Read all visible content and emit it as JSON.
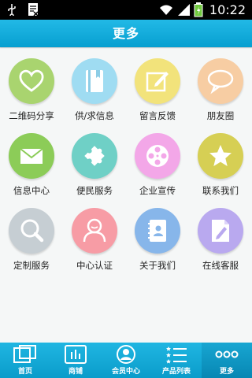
{
  "status": {
    "time": "10:22"
  },
  "header": {
    "title": "更多"
  },
  "grid": [
    {
      "label": "二维码分享",
      "icon": "heart-icon",
      "color": "#a9d46f"
    },
    {
      "label": "供/求信息",
      "icon": "book-icon",
      "color": "#9fdcf2"
    },
    {
      "label": "留言反馈",
      "icon": "edit-note-icon",
      "color": "#f2e37b"
    },
    {
      "label": "朋友圈",
      "icon": "speech-bubble-icon",
      "color": "#f7cda3"
    },
    {
      "label": "信息中心",
      "icon": "mail-icon",
      "color": "#8ccc58"
    },
    {
      "label": "便民服务",
      "icon": "puzzle-icon",
      "color": "#6fd0c6"
    },
    {
      "label": "企业宣传",
      "icon": "film-reel-icon",
      "color": "#f3a7e8"
    },
    {
      "label": "联系我们",
      "icon": "star-icon",
      "color": "#d6cf54"
    },
    {
      "label": "定制服务",
      "icon": "magnifier-icon",
      "color": "#c6ced3"
    },
    {
      "label": "中心认证",
      "icon": "user-face-icon",
      "color": "#f79ca5"
    },
    {
      "label": "关于我们",
      "icon": "contact-book-icon",
      "color": "#87b6ea"
    },
    {
      "label": "在线客服",
      "icon": "document-pen-icon",
      "color": "#b9a9ef"
    }
  ],
  "tabs": [
    {
      "label": "首页",
      "icon": "home-windows-icon"
    },
    {
      "label": "商铺",
      "icon": "shop-bars-icon"
    },
    {
      "label": "会员中心",
      "icon": "member-icon"
    },
    {
      "label": "产品列表",
      "icon": "product-list-icon"
    },
    {
      "label": "更多",
      "icon": "more-dots-icon",
      "active": true
    }
  ]
}
